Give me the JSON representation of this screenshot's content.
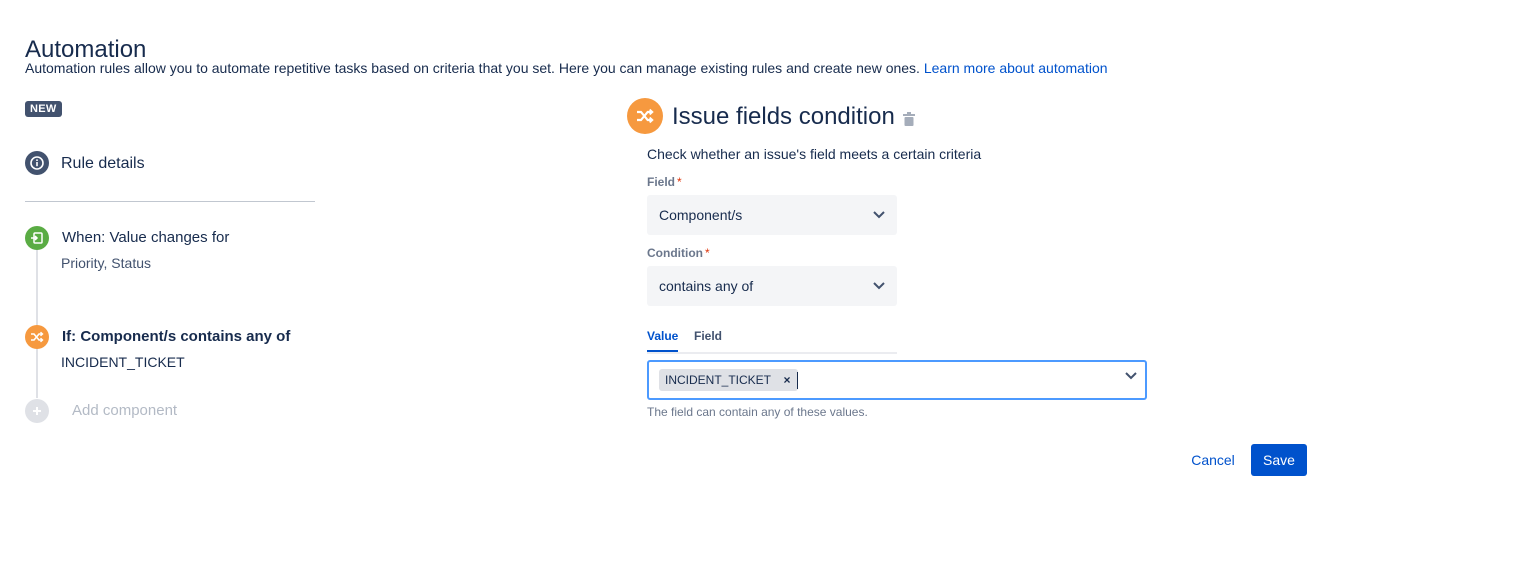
{
  "page": {
    "title": "Automation",
    "description": "Automation rules allow you to automate repetitive tasks based on criteria that you set. Here you can manage existing rules and create new ones.",
    "learn_more_link": "Learn more about automation"
  },
  "sidebar": {
    "badge": "NEW",
    "rule_details_label": "Rule details",
    "steps": [
      {
        "title": "When: Value changes for",
        "subtitle": "Priority, Status",
        "icon": "trigger-icon",
        "color": "#5aac44"
      },
      {
        "title": "If: Component/s contains any of",
        "subtitle": "INCIDENT_TICKET",
        "icon": "shuffle-icon",
        "color": "#f6993f"
      }
    ],
    "add_component_label": "Add component"
  },
  "panel": {
    "title": "Issue fields condition",
    "icon": "shuffle-icon",
    "description": "Check whether an issue's field meets a certain criteria",
    "field_label": "Field",
    "field_value": "Component/s",
    "condition_label": "Condition",
    "condition_value": "contains any of",
    "tabs": [
      "Value",
      "Field"
    ],
    "active_tab": "Value",
    "selected_values": [
      "INCIDENT_TICKET"
    ],
    "helper_text": "The field can contain any of these values.",
    "cancel_label": "Cancel",
    "save_label": "Save"
  },
  "colors": {
    "primary": "#0052cc",
    "condition": "#f6993f",
    "trigger": "#5aac44",
    "neutral": "#42526e"
  }
}
